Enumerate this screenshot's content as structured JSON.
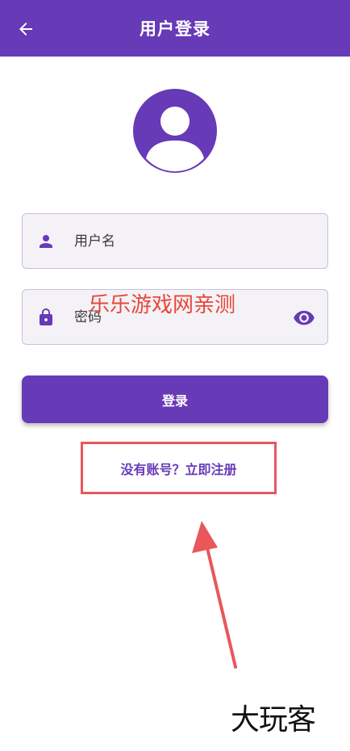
{
  "appbar": {
    "title": "用户登录",
    "back_icon": "arrow-left-icon",
    "background": "#673AB7"
  },
  "avatar": {
    "icon": "account-circle-icon"
  },
  "form": {
    "username": {
      "placeholder": "用户名",
      "value": "",
      "icon": "person-icon"
    },
    "password": {
      "placeholder": "密码",
      "value": "",
      "icon": "lock-icon",
      "toggle_icon": "eye-icon"
    },
    "login_label": "登录",
    "register_link": "没有账号？立即注册"
  },
  "annotations": {
    "watermark_top": "乐乐游戏网亲测",
    "watermark_bottom": "大玩客",
    "highlight_color": "#E9575B"
  },
  "colors": {
    "accent": "#673AB7",
    "field_bg": "#F4F2F6",
    "field_border": "#C9BEDF"
  }
}
